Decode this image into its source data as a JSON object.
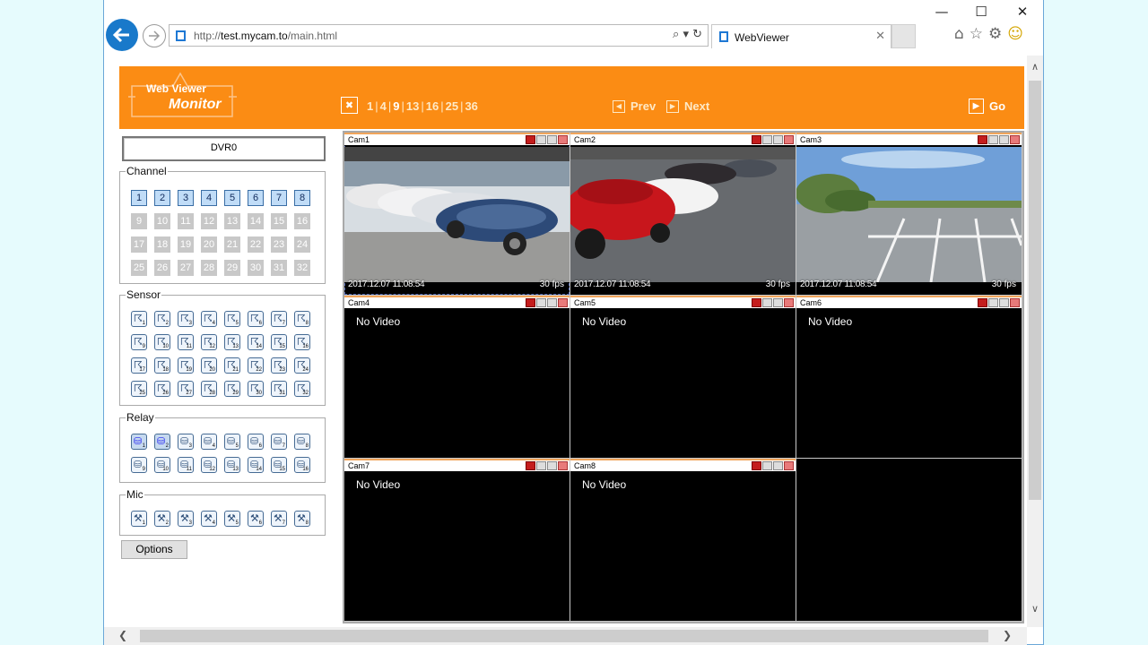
{
  "browser": {
    "url_prefix": "http://",
    "url_host": "test.mycam.to",
    "url_path": "/main.html",
    "tab_title": "WebViewer",
    "win_minimize": "—",
    "win_maximize": "☐",
    "win_close": "✕"
  },
  "header": {
    "logo_line1": "Web Viewer",
    "logo_line2": "Monitor",
    "splits": [
      "1",
      "4",
      "9",
      "13",
      "16",
      "25",
      "36"
    ],
    "current_split": "9",
    "prev_label": "Prev",
    "next_label": "Next",
    "go_label": "Go"
  },
  "panel": {
    "dvr_name": "DVR0",
    "channel_label": "Channel",
    "channels_enabled": [
      "1",
      "2",
      "3",
      "4",
      "5",
      "6",
      "7",
      "8"
    ],
    "channels_disabled": [
      "9",
      "10",
      "11",
      "12",
      "13",
      "14",
      "15",
      "16",
      "17",
      "18",
      "19",
      "20",
      "21",
      "22",
      "23",
      "24",
      "25",
      "26",
      "27",
      "28",
      "29",
      "30",
      "31",
      "32"
    ],
    "sensor_label": "Sensor",
    "sensor_count": 32,
    "relay_label": "Relay",
    "relay_count": 16,
    "relay_active": [
      1,
      2
    ],
    "mic_label": "Mic",
    "mic_count": 8,
    "options_label": "Options"
  },
  "cameras": [
    {
      "name": "Cam1",
      "timestamp": "2017.12.07 11:08:54",
      "fps": "30 fps",
      "video": true,
      "selected": true,
      "scene": "cars-row"
    },
    {
      "name": "Cam2",
      "timestamp": "2017.12.07 11:08:54",
      "fps": "30 fps",
      "video": true,
      "selected": false,
      "scene": "cars-red"
    },
    {
      "name": "Cam3",
      "timestamp": "2017.12.07 11:08:54",
      "fps": "30 fps",
      "video": true,
      "selected": false,
      "scene": "parking-lot"
    },
    {
      "name": "Cam4",
      "status": "No Video",
      "video": false
    },
    {
      "name": "Cam5",
      "status": "No Video",
      "video": false
    },
    {
      "name": "Cam6",
      "status": "No Video",
      "video": false
    },
    {
      "name": "Cam7",
      "status": "No Video",
      "video": false
    },
    {
      "name": "Cam8",
      "status": "No Video",
      "video": false
    }
  ],
  "colors": {
    "header_orange": "#fb8c14",
    "browser_accent": "#1979ca"
  }
}
